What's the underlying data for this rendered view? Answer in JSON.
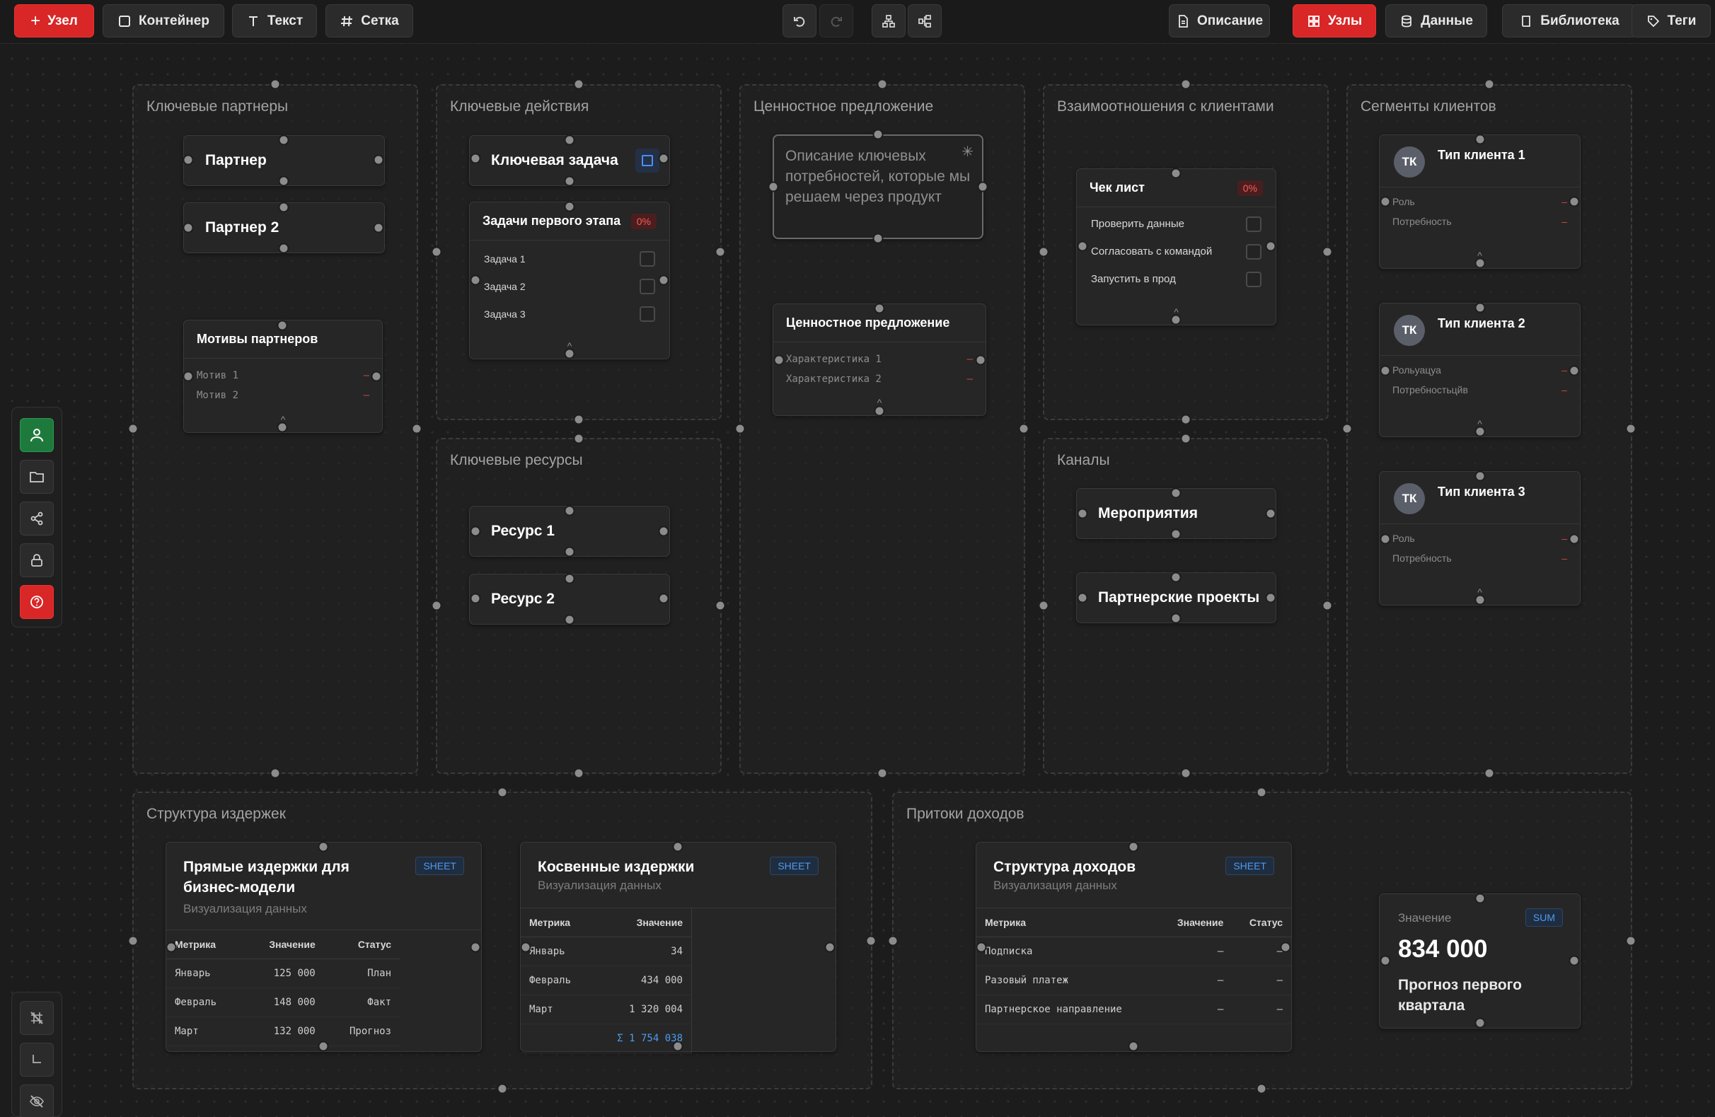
{
  "toolbar": {
    "add_node": "Узел",
    "container": "Контейнер",
    "text": "Текст",
    "grid": "Сетка",
    "description": "Описание",
    "nodes": "Узлы",
    "data": "Данные",
    "library": "Библиотека",
    "tags": "Теги"
  },
  "containers": {
    "partners": "Ключевые партнеры",
    "actions": "Ключевые действия",
    "value": "Ценностное предложение",
    "relations": "Взаимоотношения с клиентами",
    "segments": "Сегменты клиентов",
    "resources": "Ключевые ресурсы",
    "channels": "Каналы",
    "costs": "Структура издержек",
    "revenue": "Притоки доходов"
  },
  "partners": {
    "partner1": "Партнер",
    "partner2": "Партнер 2",
    "motives_title": "Мотивы партнеров",
    "motives": [
      {
        "label": "Мотив 1",
        "value": "–"
      },
      {
        "label": "Мотив 2",
        "value": "–"
      }
    ]
  },
  "actions": {
    "key_task": "Ключевая задача",
    "stage_title": "Задачи первого этапа",
    "stage_progress": "0%",
    "tasks": [
      "Задача 1",
      "Задача 2",
      "Задача 3"
    ]
  },
  "value": {
    "description": "Описание ключевых потребностей, которые мы решаем через продукт",
    "card_title": "Ценностное предложение",
    "features": [
      {
        "label": "Характеристика 1",
        "value": "–"
      },
      {
        "label": "Характеристика 2",
        "value": "–"
      }
    ]
  },
  "relations": {
    "checklist_title": "Чек лист",
    "checklist_progress": "0%",
    "items": [
      "Проверить данные",
      "Согласовать с командой",
      "Запустить в прод"
    ]
  },
  "resources": {
    "r1": "Ресурс 1",
    "r2": "Ресурс 2"
  },
  "channels": {
    "c1": "Мероприятия",
    "c2": "Партнерские проекты"
  },
  "segments": [
    {
      "avatar": "ТК",
      "title": "Тип клиента 1",
      "rows": [
        {
          "label": "Роль",
          "value": "–"
        },
        {
          "label": "Потребность",
          "value": "–"
        }
      ]
    },
    {
      "avatar": "ТК",
      "title": "Тип клиента 2",
      "rows": [
        {
          "label": "Рольуацуа",
          "value": "–"
        },
        {
          "label": "Потребностьцйв",
          "value": "–"
        }
      ]
    },
    {
      "avatar": "ТК",
      "title": "Тип клиента 3",
      "rows": [
        {
          "label": "Роль",
          "value": "–"
        },
        {
          "label": "Потребность",
          "value": "–"
        }
      ]
    }
  ],
  "costs": {
    "direct": {
      "title": "Прямые издержки для бизнес-модели",
      "subtitle": "Визуализация данных",
      "badge": "SHEET",
      "headers": [
        "Метрика",
        "Значение",
        "Статус"
      ],
      "rows": [
        [
          "Январь",
          "125 000",
          "План"
        ],
        [
          "Февраль",
          "148 000",
          "Факт"
        ],
        [
          "Март",
          "132 000",
          "Прогноз"
        ]
      ]
    },
    "indirect": {
      "title": "Косвенные издержки",
      "subtitle": "Визуализация данных",
      "badge": "SHEET",
      "headers": [
        "Метрика",
        "Значение"
      ],
      "rows": [
        [
          "Январь",
          "34"
        ],
        [
          "Февраль",
          "434 000"
        ],
        [
          "Март",
          "1 320 004"
        ]
      ],
      "sum": "Σ 1 754 038"
    }
  },
  "revenue": {
    "structure": {
      "title": "Структура доходов",
      "subtitle": "Визуализация данных",
      "badge": "SHEET",
      "headers": [
        "Метрика",
        "Значение",
        "Статус"
      ],
      "rows": [
        [
          "Подписка",
          "–",
          "–"
        ],
        [
          "Разовый платеж",
          "–",
          "–"
        ],
        [
          "Партнерское направление",
          "–",
          "–"
        ]
      ]
    },
    "sum_card": {
      "label": "Значение",
      "badge": "SUM",
      "value": "834 000",
      "caption": "Прогноз первого квартала"
    }
  },
  "colors": {
    "accent_red": "#d92626",
    "progress_red": "#ff5b5b",
    "link_blue": "#4d9bf0",
    "rail_green": "#1e7a3c"
  }
}
